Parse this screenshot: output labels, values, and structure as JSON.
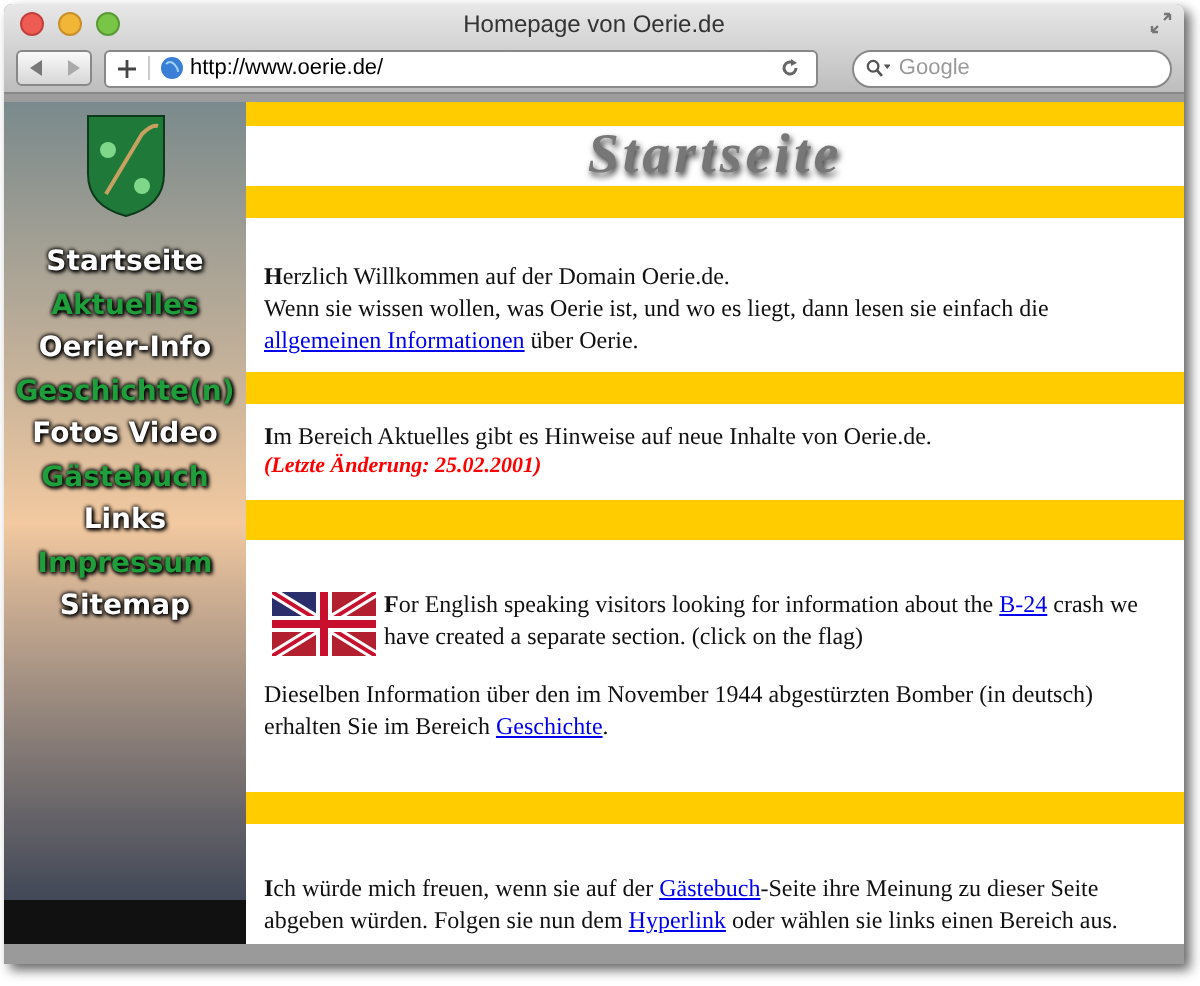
{
  "window": {
    "title": "Homepage von Oerie.de"
  },
  "toolbar": {
    "url": "http://www.oerie.de/",
    "search": {
      "placeholder": "Google"
    }
  },
  "sidebar": {
    "items": [
      {
        "label": "Startseite",
        "color": "#ffffff"
      },
      {
        "label": "Aktuelles",
        "color": "#1f9e3c"
      },
      {
        "label": "Oerier-Info",
        "color": "#ffffff"
      },
      {
        "label": "Geschichte(n)",
        "color": "#1f9e3c"
      },
      {
        "label": "Fotos Video",
        "color": "#ffffff"
      },
      {
        "label": "Gästebuch",
        "color": "#1f9e3c"
      },
      {
        "label": "Links",
        "color": "#ffffff"
      },
      {
        "label": "Impressum",
        "color": "#1f9e3c"
      },
      {
        "label": "Sitemap",
        "color": "#ffffff"
      }
    ]
  },
  "content": {
    "heading": "Startseite",
    "sections": [
      [
        {
          "kind": "text",
          "segments": [
            {
              "kind": "text",
              "text": "**H**erzlich Willkommen auf der Domain Oerie.de.\nWenn sie wissen wollen, was Oerie ist, und wo es liegt, dann lesen sie einfach die\n"
            },
            {
              "kind": "link",
              "text": "allgemeinen Informationen"
            },
            {
              "kind": "text",
              "text": " über Oerie."
            }
          ]
        }
      ],
      [
        {
          "kind": "text",
          "segments": [
            {
              "kind": "text",
              "text": "**I**m Bereich Aktuelles gibt es Hinweise auf neue Inhalte von Oerie.de."
            }
          ]
        },
        {
          "kind": "note",
          "segments": [
            {
              "kind": "text",
              "text": "(Letzte Änderung: 25.02.2001)"
            }
          ]
        }
      ],
      [
        {
          "kind": "flag",
          "segments": [
            {
              "kind": "text",
              "text": "**F**or English speaking visitors looking for information about the "
            },
            {
              "kind": "link",
              "text": "B-24"
            },
            {
              "kind": "text",
              "text": " crash we have created a separate section. (click on the flag)"
            }
          ]
        },
        {
          "kind": "text",
          "segments": [
            {
              "kind": "text",
              "text": "Dieselben Information über den im November 1944 abgestürzten Bomber (in deutsch) erhalten Sie im Bereich "
            },
            {
              "kind": "link",
              "text": "Geschichte"
            },
            {
              "kind": "text",
              "text": "."
            }
          ]
        }
      ],
      [
        {
          "kind": "text",
          "segments": [
            {
              "kind": "text",
              "text": "**I**ch würde mich freuen, wenn sie auf der "
            },
            {
              "kind": "link",
              "text": "Gästebuch"
            },
            {
              "kind": "text",
              "text": "-Seite ihre Meinung zu dieser Seite abgeben würden. Folgen sie nun dem "
            },
            {
              "kind": "link",
              "text": "Hyperlink"
            },
            {
              "kind": "text",
              "text": " oder wählen sie links einen Bereich aus."
            }
          ]
        }
      ]
    ]
  }
}
